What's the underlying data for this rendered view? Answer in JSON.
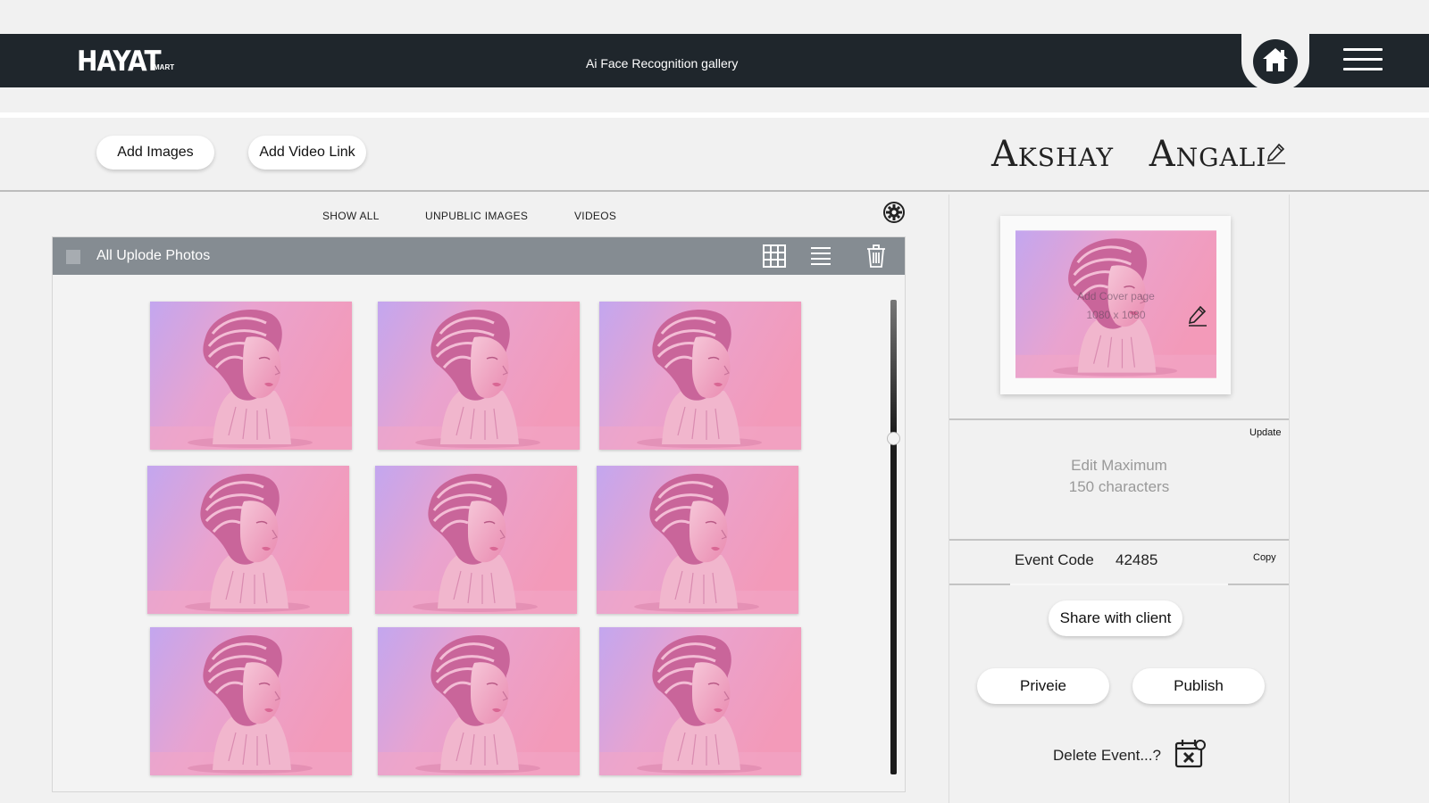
{
  "header": {
    "logo_main": "HAYAT",
    "logo_sub": "MART",
    "title": "Ai Face Recognition gallery"
  },
  "toolbar": {
    "add_images_label": "Add Images",
    "add_video_label": "Add Video Link",
    "event_name": "Akshay Angali"
  },
  "tabs": [
    {
      "label": "SHOW ALL"
    },
    {
      "label": "UNPUBLIC IMAGES"
    },
    {
      "label": "VIDEOS"
    }
  ],
  "gallery": {
    "title": "All Uplode Photos",
    "photo_count": 9
  },
  "side": {
    "cover_line1": "Add Cover page",
    "cover_line2": "1080 x 1080",
    "update_label": "Update",
    "desc_line1": "Edit Maximum",
    "desc_line2": "150 characters",
    "event_code_label": "Event Code",
    "event_code": "42485",
    "copy_label": "Copy",
    "share_label": "Share with client",
    "preview_label": "Priveie",
    "publish_label": "Publish",
    "delete_label": "Delete Event...?"
  },
  "colors": {
    "header_bg": "#1f262c",
    "gallery_bar": "#858c92",
    "photo_pink": "#f19bbd",
    "photo_violet": "#c0a6ee"
  },
  "icons": [
    "home-icon",
    "hamburger-menu-icon",
    "pencil-icon",
    "settings-gear-icon",
    "grid-view-icon",
    "list-view-icon",
    "trash-icon",
    "calendar-delete-icon"
  ]
}
